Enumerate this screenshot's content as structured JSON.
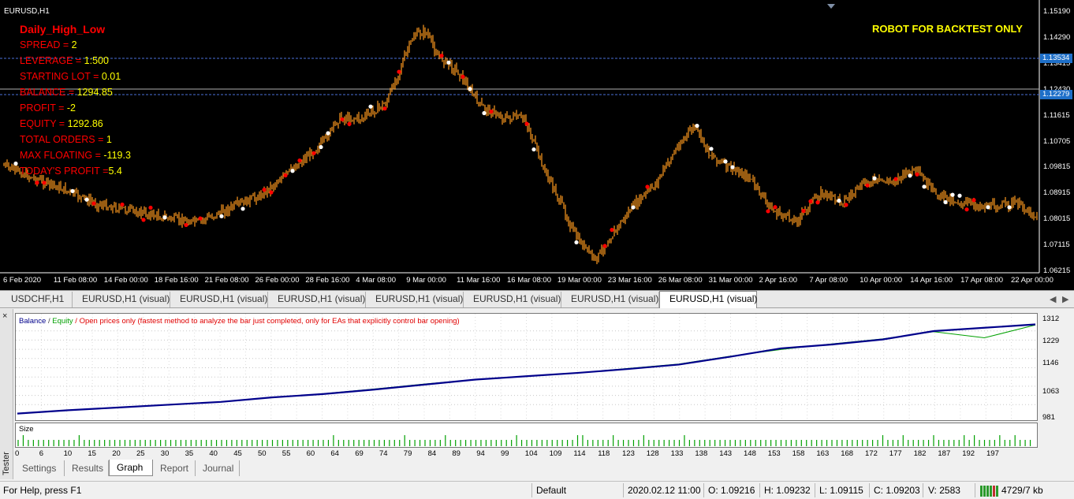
{
  "chart": {
    "symbol": "EURUSD,H1",
    "robot_note": "ROBOT FOR BACKTEST ONLY",
    "info": {
      "title": "Daily_High_Low",
      "rows": [
        {
          "label": "SPREAD = ",
          "value": "2"
        },
        {
          "label": "LEVERAGE = ",
          "value": "1:500"
        },
        {
          "label": "STARTING LOT = ",
          "value": "0.01"
        },
        {
          "label": "BALANCE = ",
          "value": "1294.85"
        },
        {
          "label": "PROFIT = ",
          "value": "-2"
        },
        {
          "label": "EQUITY = ",
          "value": "1292.86"
        },
        {
          "label": "TOTAL ORDERS = ",
          "value": "1"
        },
        {
          "label": "MAX FLOATING = ",
          "value": "-119.3"
        },
        {
          "label": "TODAY'S PROFIT =",
          "value": "5.4"
        }
      ]
    },
    "price_ticks": [
      "1.15190",
      "1.14290",
      "1.13415",
      "1.12430",
      "1.11615",
      "1.10705",
      "1.09815",
      "1.08915",
      "1.08015",
      "1.07115",
      "1.06215"
    ],
    "price_tags": [
      "1.13534",
      "1.12279"
    ],
    "time_ticks": [
      "6 Feb 2020",
      "11 Feb 08:00",
      "14 Feb 00:00",
      "18 Feb 16:00",
      "21 Feb 08:00",
      "26 Feb 00:00",
      "28 Feb 16:00",
      "4 Mar 08:00",
      "9 Mar 00:00",
      "11 Mar 16:00",
      "16 Mar 08:00",
      "19 Mar 00:00",
      "23 Mar 16:00",
      "26 Mar 08:00",
      "31 Mar 00:00",
      "2 Apr 16:00",
      "7 Apr 08:00",
      "10 Apr 00:00",
      "14 Apr 16:00",
      "17 Apr 08:00",
      "22 Apr 00:00"
    ],
    "colors": {
      "background": "#000000",
      "candles": "#ff9a1e",
      "lines": "#4a6fd8",
      "buy_marker": "#ff0000",
      "sell_marker": "#ffffff"
    }
  },
  "chart_tabs": [
    "USDCHF,H1",
    "EURUSD,H1 (visual)",
    "EURUSD,H1 (visual)",
    "EURUSD,H1 (visual)",
    "EURUSD,H1 (visual)",
    "EURUSD,H1 (visual)",
    "EURUSD,H1 (visual)",
    "EURUSD,H1 (visual)"
  ],
  "chart_tab_active": 7,
  "tester": {
    "side_label": "Tester",
    "close_glyph": "×",
    "legend": {
      "balance": "Balance",
      "sep": " / ",
      "equity": "Equity",
      "note": " / Open prices only (fastest method to analyze the bar just completed, only for EAs that explicitly control bar opening)"
    },
    "size_label": "Size",
    "y_ticks": [
      "1312",
      "1229",
      "1146",
      "1063",
      "981"
    ],
    "x_ticks": [
      "0",
      "6",
      "10",
      "15",
      "20",
      "25",
      "30",
      "35",
      "40",
      "45",
      "50",
      "55",
      "60",
      "64",
      "69",
      "74",
      "79",
      "84",
      "89",
      "94",
      "99",
      "104",
      "109",
      "114",
      "118",
      "123",
      "128",
      "133",
      "138",
      "143",
      "148",
      "153",
      "158",
      "163",
      "168",
      "172",
      "177",
      "182",
      "187",
      "192",
      "197"
    ],
    "tabs": [
      "Settings",
      "Results",
      "Graph",
      "Report",
      "Journal"
    ],
    "active_tab": 2,
    "chart_data": {
      "type": "line",
      "x": [
        0,
        10,
        20,
        30,
        40,
        50,
        60,
        70,
        80,
        90,
        100,
        110,
        120,
        130,
        140,
        150,
        160,
        170,
        180,
        190,
        200
      ],
      "ylim": [
        981,
        1312
      ],
      "series": [
        {
          "name": "Balance",
          "values": [
            982,
            994,
            1004,
            1014,
            1024,
            1040,
            1052,
            1068,
            1086,
            1104,
            1116,
            1128,
            1142,
            1158,
            1186,
            1216,
            1230,
            1248,
            1278,
            1290,
            1302
          ]
        },
        {
          "name": "Equity",
          "values": [
            982,
            994,
            1004,
            1014,
            1024,
            1040,
            1053,
            1070,
            1088,
            1104,
            1116,
            1128,
            1144,
            1160,
            1188,
            1212,
            1232,
            1250,
            1276,
            1254,
            1300
          ]
        }
      ]
    }
  },
  "status": {
    "help": "For Help, press F1",
    "profile": "Default",
    "datetime": "2020.02.12 11:00",
    "open": "O: 1.09216",
    "high": "H: 1.09232",
    "low": "L: 1.09115",
    "close": "C: 1.09203",
    "volume": "V: 2583",
    "traffic": "4729/7 kb"
  }
}
